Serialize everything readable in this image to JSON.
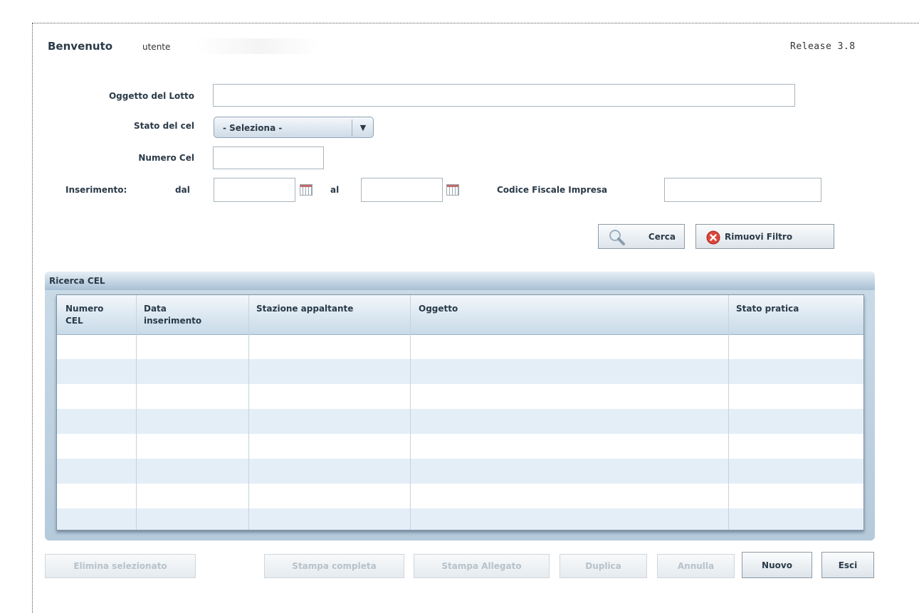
{
  "header": {
    "welcome": "Benvenuto",
    "user_label": "utente",
    "release": "Release 3.8"
  },
  "form": {
    "oggetto_label": "Oggetto del Lotto",
    "oggetto_value": "",
    "stato_label": "Stato del cel",
    "stato_value": "- Seleziona -",
    "numero_label": "Numero Cel",
    "numero_value": "",
    "inserimento_label": "Inserimento:",
    "dal_label": "dal",
    "dal_value": "",
    "al_label": "al",
    "al_value": "",
    "codice_label": "Codice Fiscale Impresa",
    "codice_value": ""
  },
  "search_buttons": {
    "cerca": "Cerca",
    "rimuovi": "Rimuovi Filtro"
  },
  "grid": {
    "title": "Ricerca CEL",
    "columns": [
      {
        "line1": "Numero",
        "line2": "CEL"
      },
      {
        "line1": "Data",
        "line2": "inserimento"
      },
      {
        "line1": "Stazione appaltante",
        "line2": ""
      },
      {
        "line1": "Oggetto",
        "line2": ""
      },
      {
        "line1": "Stato pratica",
        "line2": ""
      }
    ],
    "rows": []
  },
  "footer_buttons": {
    "elimina": "Elimina selezionato",
    "stampa_completa": "Stampa completa",
    "stampa_allegato": "Stampa Allegato",
    "duplica": "Duplica",
    "annulla": "Annulla",
    "nuovo": "Nuovo",
    "esci": "Esci"
  },
  "colors": {
    "accent": "#b5cadb",
    "text": "#2a3a48",
    "disabled_text": "#b7c2cb",
    "error_icon": "#d9483b"
  }
}
